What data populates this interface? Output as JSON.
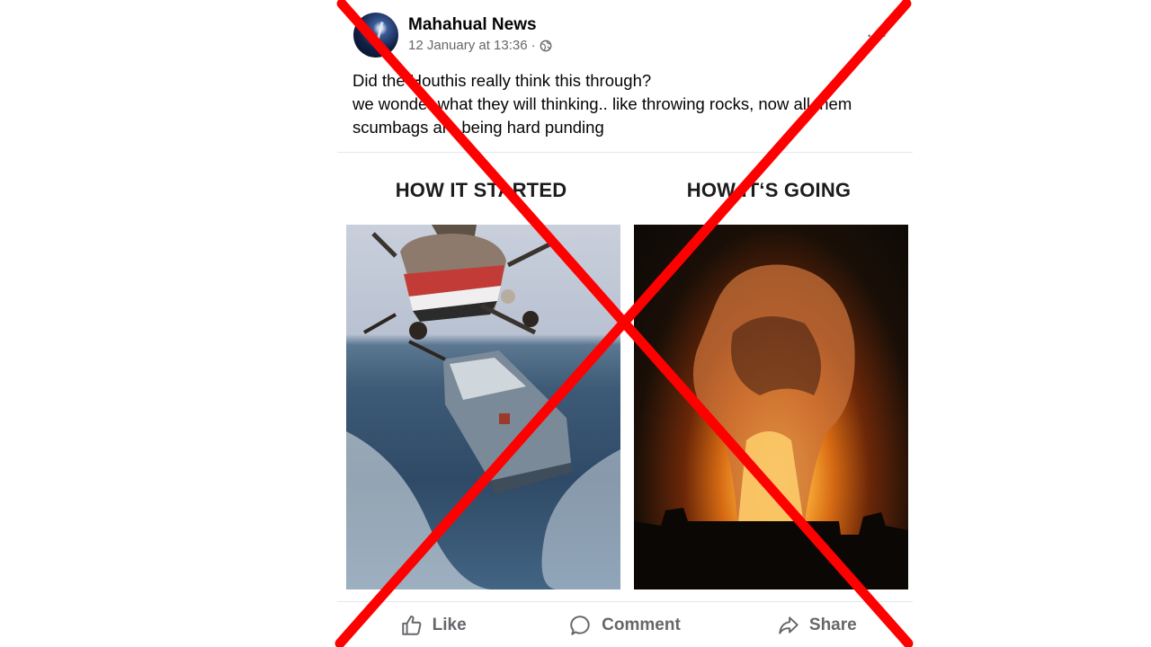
{
  "post": {
    "author": "Mahahual News",
    "timestamp": "12 January at 13:36",
    "separator": "·",
    "privacy_icon": "globe-icon",
    "more_icon": "more-options-icon",
    "more_label": "···",
    "text_lines": [
      "Did the Houthis really think this through?",
      "we wonder what they will thinking.. like throwing rocks, now all them",
      "scumbags are being hard punding"
    ]
  },
  "meme": {
    "left_caption": "HOW IT STARTED",
    "right_caption": "HOW IT‘S GOING",
    "left_image": "helicopter-over-ship-photo",
    "right_image": "night-explosion-photo"
  },
  "actions": {
    "like": "Like",
    "comment": "Comment",
    "share": "Share"
  },
  "overlay": {
    "type": "red-x-cross",
    "color": "#ff0000"
  }
}
